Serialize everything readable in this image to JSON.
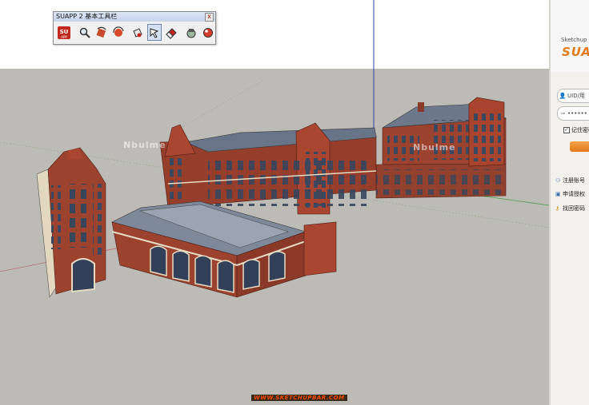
{
  "toolbar": {
    "title": "SUAPP 2 基本工具栏",
    "close_label": "x",
    "buttons": [
      {
        "name": "suapp-logo-button",
        "icon": "suapp-logo-icon",
        "label": "SU"
      },
      {
        "name": "zoom-button",
        "icon": "magnifier-icon"
      },
      {
        "name": "rotate-button",
        "icon": "rotate-icon"
      },
      {
        "name": "orbit-button",
        "icon": "orbit-icon"
      },
      {
        "name": "paint-button",
        "icon": "paint-bucket-icon"
      },
      {
        "name": "select-button",
        "icon": "select-arrow-icon",
        "active": true
      },
      {
        "name": "eraser-button",
        "icon": "eraser-icon"
      },
      {
        "name": "component-button",
        "icon": "component-icon"
      },
      {
        "name": "material-button",
        "icon": "material-icon"
      }
    ]
  },
  "watermarks": [
    "Nbulme",
    "Nbulme"
  ],
  "site_link": "WWW.SKETCHUPBAR.COM",
  "panel": {
    "app_name": "Sketchup",
    "logo_text": "SUA",
    "uid_placeholder": "UID/用",
    "password_mask": "••••••",
    "remember_label": "记住密码",
    "links": [
      "注册账号",
      "申请授权",
      "找回密码"
    ]
  },
  "colors": {
    "sky": "#ffffff",
    "ground": "#bdbbb5",
    "brick": "#9a3c2a",
    "roof": "#6f7b8c",
    "trim": "#e6dcc4",
    "accent": "#e07a1c"
  }
}
